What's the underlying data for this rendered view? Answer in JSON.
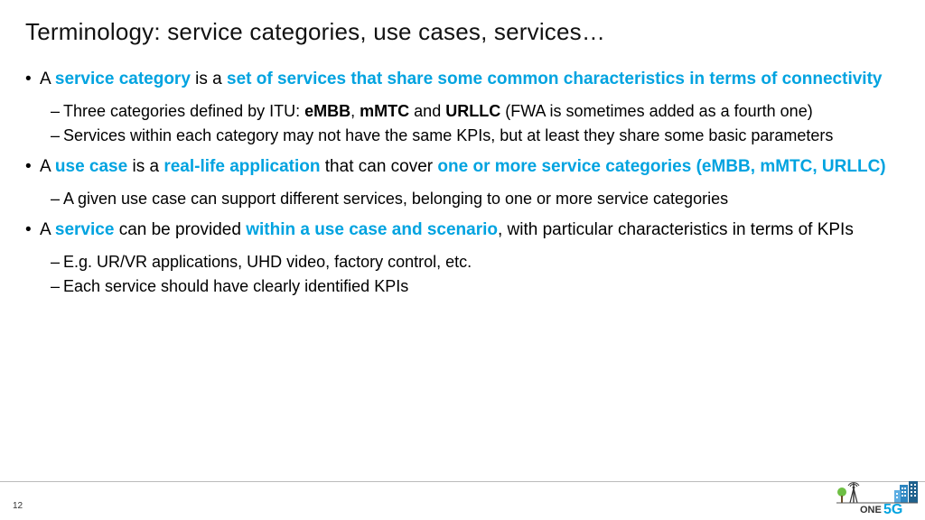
{
  "title": "Terminology: service categories, use cases, services…",
  "b1": {
    "t0": "A ",
    "hl1": "service category ",
    "t1": "is a ",
    "hl2": "set of services that share some common characteristics in terms of connectivity",
    "s1a": "Three categories defined by ITU: ",
    "s1b1": "eMBB",
    "s1c": ", ",
    "s1b2": "mMTC",
    "s1d": " and ",
    "s1b3": "URLLC",
    "s1e": " (FWA is sometimes added as a fourth one)",
    "s2": "Services within each category may not have the same KPIs, but at least they share some basic parameters"
  },
  "b2": {
    "t0": "A ",
    "hl1": "use case ",
    "t1": "is a ",
    "hl2": "real-life application ",
    "t2": "that can cover ",
    "hl3": "one or more service categories (eMBB, mMTC, URLLC)",
    "s1": "A given use case can support different services, belonging to one or more service categories"
  },
  "b3": {
    "t0": "A ",
    "hl1": "service ",
    "t1": "can be provided ",
    "hl2": "within a use case and scenario",
    "t2": ", with particular characteristics in terms of KPIs",
    "s1": "E.g. UR/VR applications, UHD video, factory control, etc.",
    "s2": "Each service should have clearly identified KPIs"
  },
  "page_number": "12",
  "logo": {
    "one": "ONE",
    "fiveg": "5G"
  }
}
